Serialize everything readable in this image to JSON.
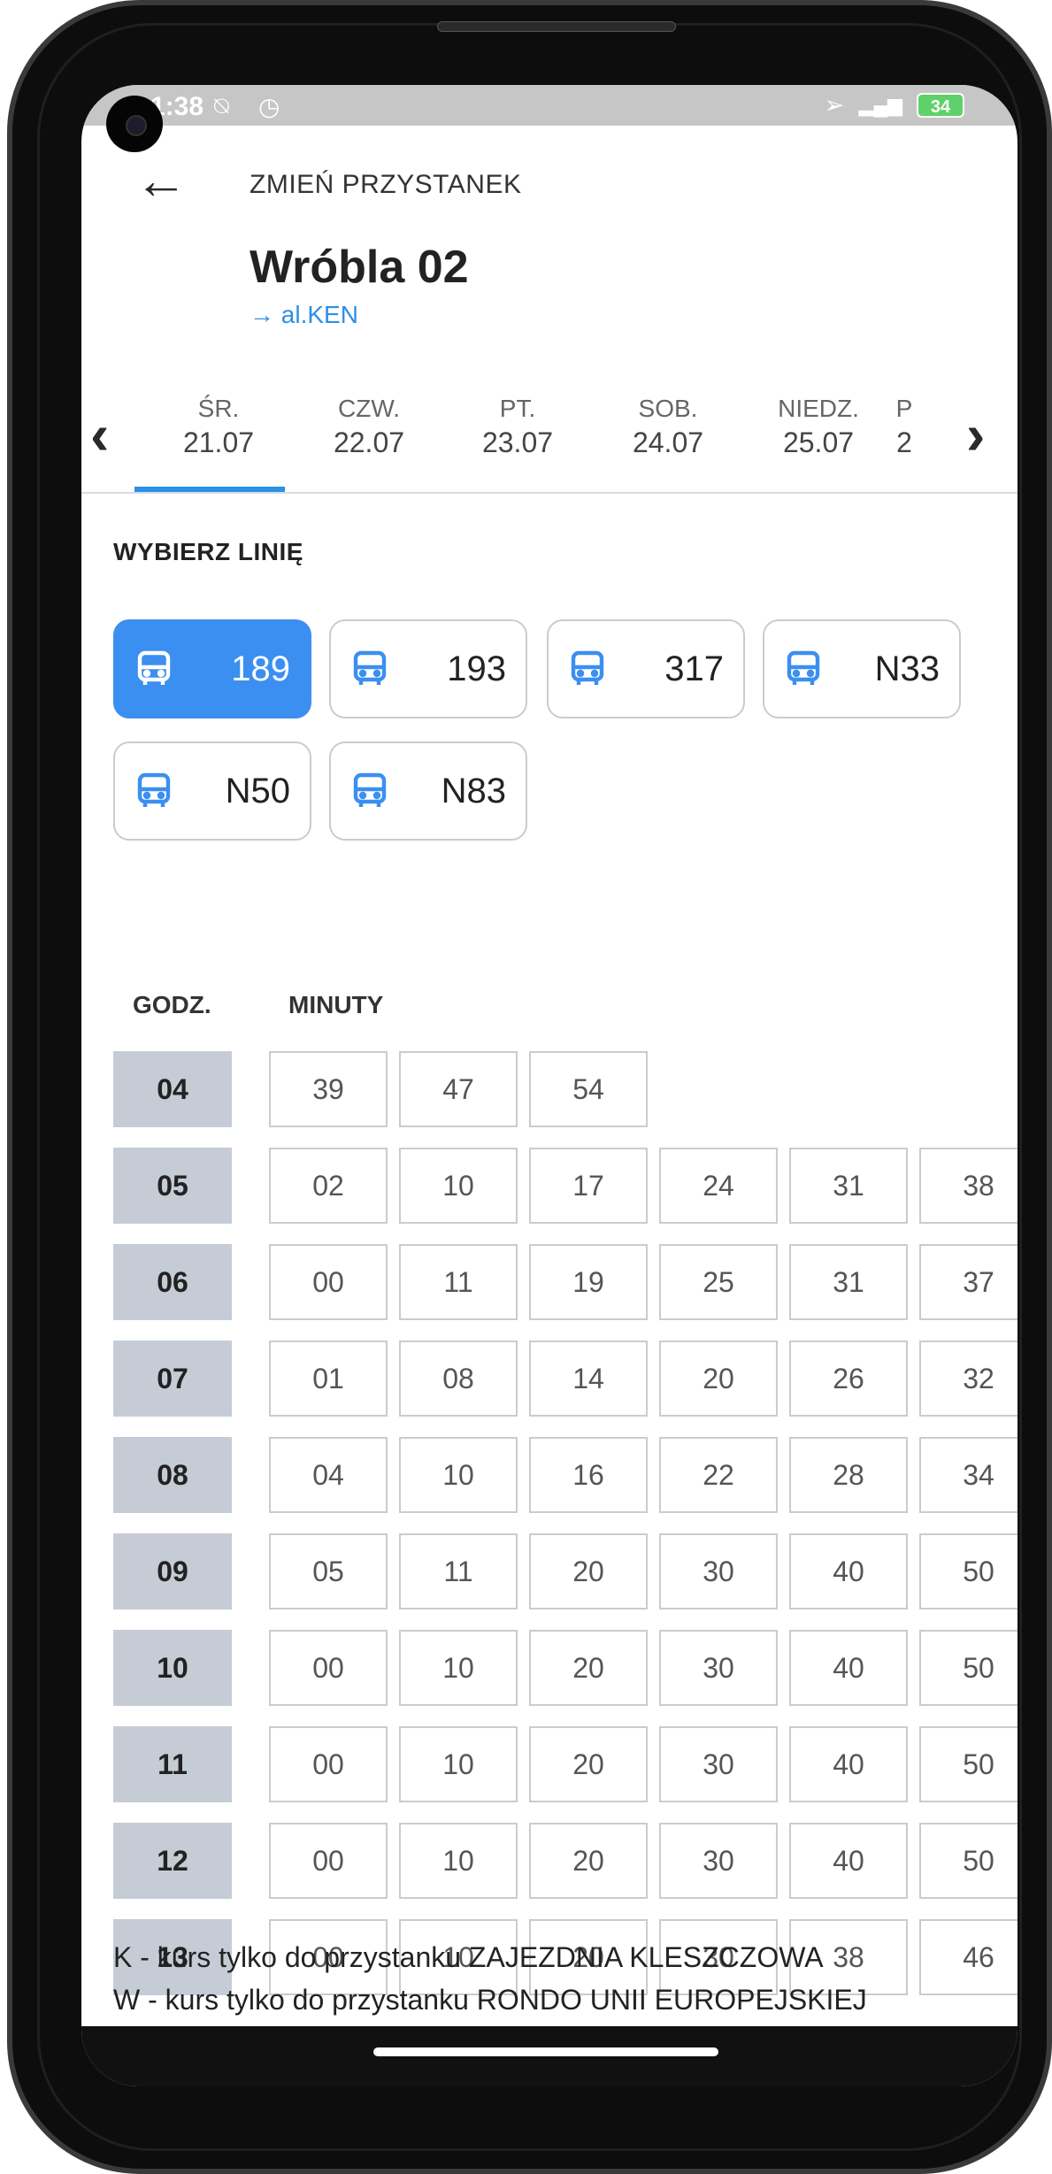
{
  "status_bar": {
    "time": "1:38"
  },
  "header": {
    "action_label": "ZMIEŃ PRZYSTANEK",
    "stop_name": "Wróbla 02",
    "direction": "→ al.KEN"
  },
  "days": [
    {
      "name": "ŚR.",
      "date": "21.07",
      "selected": true
    },
    {
      "name": "CZW.",
      "date": "22.07"
    },
    {
      "name": "PT.",
      "date": "23.07"
    },
    {
      "name": "SOB.",
      "date": "24.07"
    },
    {
      "name": "NIEDZ.",
      "date": "25.07"
    },
    {
      "name": "P",
      "date": "2"
    }
  ],
  "lines": {
    "title": "WYBIERZ LINIĘ",
    "items": [
      {
        "number": "189",
        "active": true
      },
      {
        "number": "193"
      },
      {
        "number": "317"
      },
      {
        "number": "N33"
      },
      {
        "number": "N50"
      },
      {
        "number": "N83"
      }
    ]
  },
  "timetable": {
    "hour_header": "GODZ.",
    "minutes_header": "MINUTY",
    "rows": [
      {
        "hour": "04",
        "minutes": [
          "39",
          "47",
          "54"
        ]
      },
      {
        "hour": "05",
        "minutes": [
          "02",
          "10",
          "17",
          "24",
          "31",
          "38"
        ]
      },
      {
        "hour": "06",
        "minutes": [
          "00",
          "11",
          "19",
          "25",
          "31",
          "37"
        ]
      },
      {
        "hour": "07",
        "minutes": [
          "01",
          "08",
          "14",
          "20",
          "26",
          "32"
        ]
      },
      {
        "hour": "08",
        "minutes": [
          "04",
          "10",
          "16",
          "22",
          "28",
          "34"
        ]
      },
      {
        "hour": "09",
        "minutes": [
          "05",
          "11",
          "20",
          "30",
          "40",
          "50"
        ]
      },
      {
        "hour": "10",
        "minutes": [
          "00",
          "10",
          "20",
          "30",
          "40",
          "50"
        ]
      },
      {
        "hour": "11",
        "minutes": [
          "00",
          "10",
          "20",
          "30",
          "40",
          "50"
        ]
      },
      {
        "hour": "12",
        "minutes": [
          "00",
          "10",
          "20",
          "30",
          "40",
          "50"
        ]
      },
      {
        "hour": "13",
        "minutes": [
          "00",
          "10",
          "20",
          "30",
          "38",
          "46"
        ]
      }
    ]
  },
  "notes": [
    "K - kurs tylko do przystanku ZAJEZDNIA KLESZCZOWA",
    "W - kurs tylko do przystanku RONDO UNII EUROPEJSKIEJ"
  ],
  "colors": {
    "accent": "#3b8ff0",
    "hour_bg": "#c6ccd6"
  }
}
